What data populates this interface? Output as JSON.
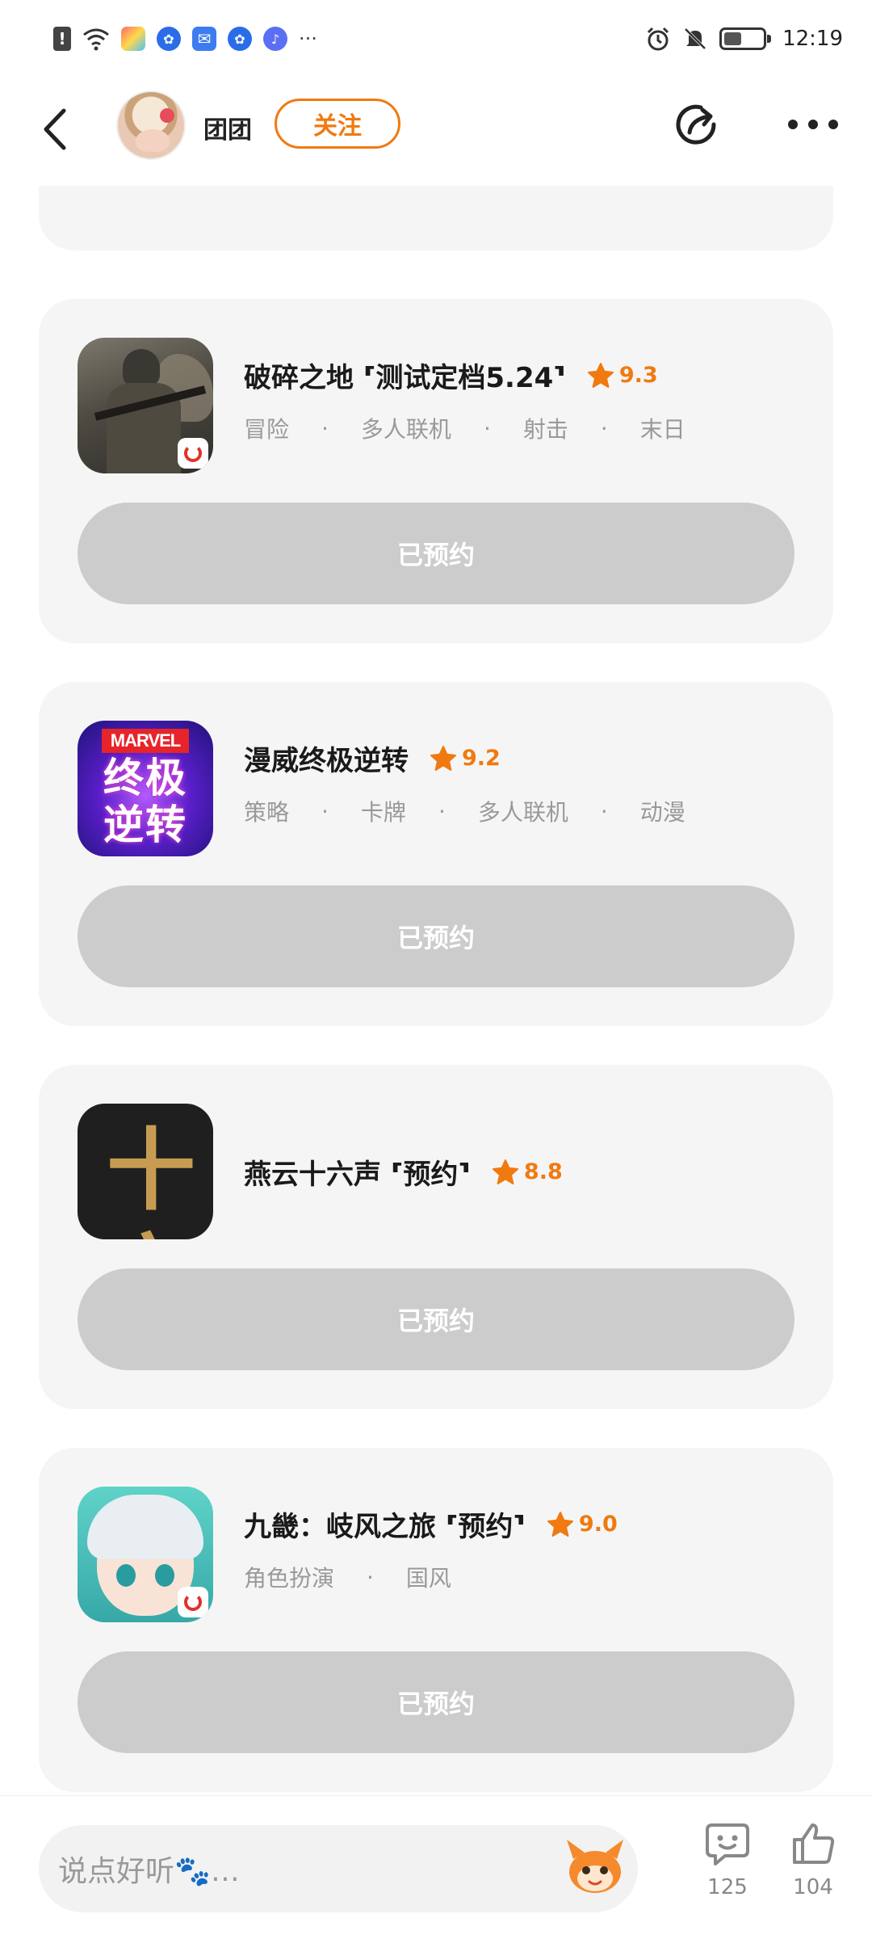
{
  "status_bar": {
    "time": "12:19",
    "battery_level": 0.45,
    "left_icons": [
      "alert-icon",
      "wifi-icon",
      "app-icon",
      "paw-icon",
      "mail-icon",
      "paw-icon",
      "music-icon",
      "more-icon"
    ],
    "right_icons": [
      "alarm-icon",
      "mute-icon",
      "battery-icon"
    ]
  },
  "header": {
    "user_name": "团团",
    "follow_label": "关注"
  },
  "games": [
    {
      "title": "破碎之地 ⸢测试定档5.24⸣",
      "rating": "9.3",
      "tags": [
        "冒险",
        "多人联机",
        "射击",
        "末日"
      ],
      "button_label": "已预约"
    },
    {
      "title": "漫威终极逆转",
      "rating": "9.2",
      "tags": [
        "策略",
        "卡牌",
        "多人联机",
        "动漫"
      ],
      "button_label": "已预约",
      "icon_banner": "MARVEL",
      "icon_text": "终极逆转"
    },
    {
      "title": "燕云十六声 ⸢预约⸣",
      "rating": "8.8",
      "tags": [],
      "button_label": "已预约",
      "icon_text": "十六"
    },
    {
      "title": "九畿：岐风之旅 ⸢预约⸣",
      "rating": "9.0",
      "tags": [
        "角色扮演",
        "国风"
      ],
      "button_label": "已预约"
    }
  ],
  "partial_card": {
    "button_label": ""
  },
  "bottom_bar": {
    "comment_placeholder": "说点好听🐾…",
    "comment_count": "125",
    "like_count": "104"
  },
  "colors": {
    "accent": "#f07a10",
    "card_bg": "#f5f5f5",
    "button_disabled": "#cccccc"
  }
}
